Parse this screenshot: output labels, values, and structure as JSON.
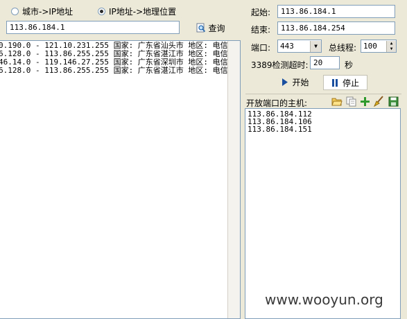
{
  "mode_radio": {
    "city_to_ip": "城市->IP地址",
    "ip_to_geo": "IP地址->地理位置"
  },
  "query": {
    "input_value": "113.86.184.1",
    "button_label": "查询"
  },
  "results": [
    "0.190.0 - 121.10.231.255 国家: 广东省汕头市 地区: 电信",
    "6.128.0 - 113.86.255.255 国家: 广东省湛江市 地区: 电信",
    "46.14.0 - 119.146.27.255 国家: 广东省深圳市 地区: 电信",
    "6.128.0 - 113.86.255.255 国家: 广东省湛江市 地区: 电信"
  ],
  "scan": {
    "start_label": "起始:",
    "start_value": "113.86.184.1",
    "end_label": "结束:",
    "end_value": "113.86.184.254",
    "port_label": "端口:",
    "port_value": "443",
    "threads_label": "总线程:",
    "threads_value": "100",
    "timeout_label": "3389检测超时:",
    "timeout_value": "20",
    "timeout_unit": "秒",
    "start_button": "开始",
    "stop_button": "停止"
  },
  "open_hosts": {
    "label": "开放端口的主机:",
    "hosts": [
      "113.86.184.112",
      "113.86.184.106",
      "113.86.184.151"
    ]
  },
  "watermark": "www.wooyun.org",
  "colors": {
    "window_bg": "#ece9d8",
    "field_border": "#7f9db9",
    "play_icon": "#1a4fa0",
    "pause_icon": "#1a4fa0"
  },
  "icons": [
    "folder-open-icon",
    "copy-icon",
    "add-icon",
    "clear-brush-icon",
    "save-icon",
    "search-icon",
    "play-icon",
    "pause-icon"
  ]
}
